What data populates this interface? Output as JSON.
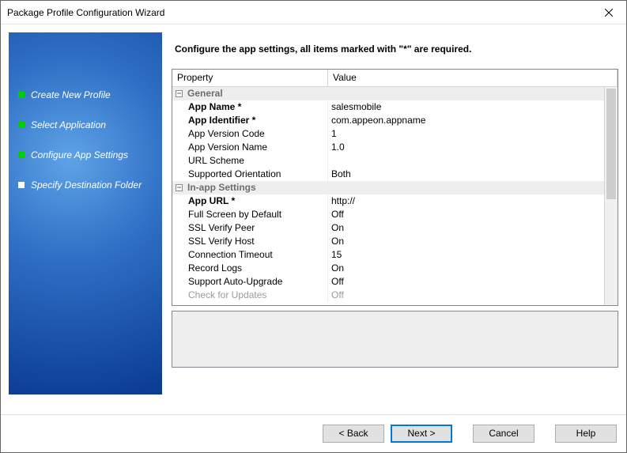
{
  "window": {
    "title": "Package Profile Configuration Wizard"
  },
  "sidebar": {
    "steps": [
      {
        "label": "Create New Profile",
        "state": "done"
      },
      {
        "label": "Select Application",
        "state": "done"
      },
      {
        "label": "Configure App Settings",
        "state": "done"
      },
      {
        "label": "Specify Destination Folder",
        "state": "pending"
      }
    ]
  },
  "main": {
    "instruction": "Configure the app settings, all items marked with \"*\" are required.",
    "columns": {
      "property": "Property",
      "value": "Value"
    },
    "rows": [
      {
        "type": "group",
        "label": "General"
      },
      {
        "type": "prop",
        "bold": true,
        "label": "App Name *",
        "value": "salesmobile"
      },
      {
        "type": "prop",
        "bold": true,
        "label": "App Identifier *",
        "value": "com.appeon.appname"
      },
      {
        "type": "prop",
        "bold": false,
        "label": "App Version Code",
        "value": "1"
      },
      {
        "type": "prop",
        "bold": false,
        "label": "App Version Name",
        "value": "1.0"
      },
      {
        "type": "prop",
        "bold": false,
        "label": "URL Scheme",
        "value": ""
      },
      {
        "type": "prop",
        "bold": false,
        "label": "Supported Orientation",
        "value": "Both"
      },
      {
        "type": "group",
        "label": "In-app Settings"
      },
      {
        "type": "prop",
        "bold": true,
        "label": "App URL *",
        "value": "http://"
      },
      {
        "type": "prop",
        "bold": false,
        "label": "Full Screen by Default",
        "value": "Off"
      },
      {
        "type": "prop",
        "bold": false,
        "label": "SSL Verify Peer",
        "value": "On"
      },
      {
        "type": "prop",
        "bold": false,
        "label": "SSL Verify Host",
        "value": "On"
      },
      {
        "type": "prop",
        "bold": false,
        "label": "Connection Timeout",
        "value": "15"
      },
      {
        "type": "prop",
        "bold": false,
        "label": "Record Logs",
        "value": "On"
      },
      {
        "type": "prop",
        "bold": false,
        "label": "Support Auto-Upgrade",
        "value": "Off"
      },
      {
        "type": "prop",
        "bold": false,
        "label": "Check for Updates",
        "value": "Off",
        "disabled": true
      }
    ]
  },
  "footer": {
    "back": "< Back",
    "next": "Next >",
    "cancel": "Cancel",
    "help": "Help"
  }
}
